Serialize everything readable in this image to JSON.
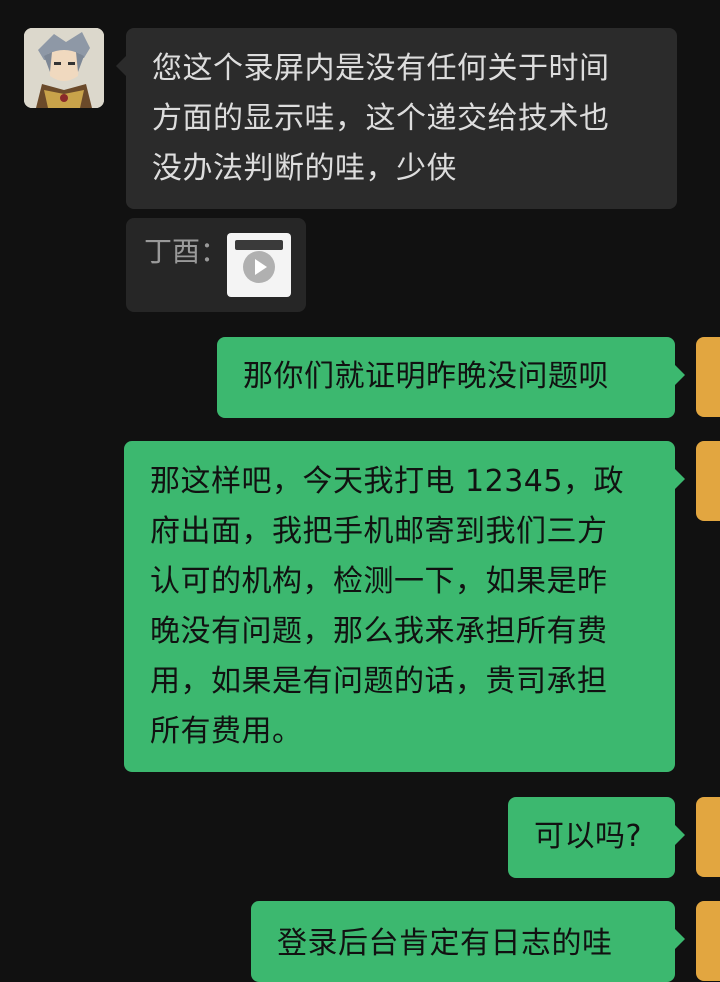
{
  "colors": {
    "background": "#111111",
    "incoming_bubble": "#2b2b2b",
    "incoming_text": "#dddddd",
    "outgoing_bubble": "#3cb86f",
    "outgoing_text": "#111111",
    "quote_label": "#9a9a9a",
    "self_avatar": "#e2a640"
  },
  "messages": {
    "m1": {
      "sender": "other",
      "lines": [
        "您这个录屏内是没有任何关于时间",
        "方面的显示哇，这个递交给技术也",
        "没办法判断的哇，少侠"
      ]
    },
    "quote": {
      "label": "丁酉：",
      "attachment_icon": "video-play-icon"
    },
    "m2": {
      "sender": "self",
      "lines": [
        "那你们就证明昨晚没问题呗"
      ]
    },
    "m3": {
      "sender": "self",
      "lines": [
        "那这样吧，今天我打电 12345，政",
        "府出面，我把手机邮寄到我们三方",
        "认可的机构，检测一下，如果是昨",
        "晚没有问题，那么我来承担所有费",
        "用，如果是有问题的话，贵司承担",
        "所有费用。"
      ]
    },
    "m4": {
      "sender": "self",
      "lines": [
        "可以吗?"
      ]
    },
    "m5": {
      "sender": "self",
      "lines": [
        "登录后台肯定有日志的哇"
      ]
    }
  }
}
